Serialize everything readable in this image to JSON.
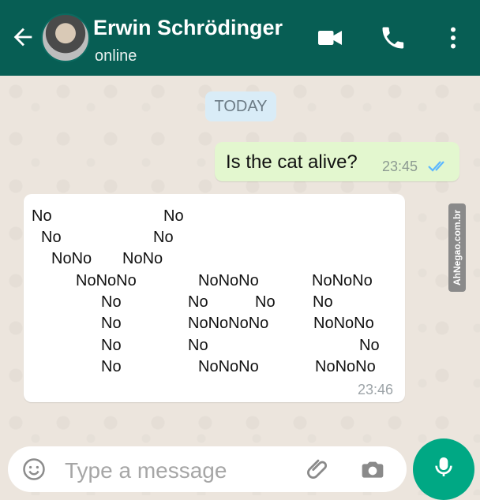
{
  "header": {
    "title": "Erwin Schrödinger",
    "status": "online"
  },
  "chat": {
    "date_label": "TODAY",
    "outgoing": {
      "text": "Is the cat alive?",
      "time": "23:45"
    },
    "incoming": {
      "time": "23:46",
      "rows": [
        {
          "parts": [
            "No",
            "No"
          ]
        },
        {
          "parts": [
            "No",
            "No"
          ]
        },
        {
          "parts": [
            "NoNo",
            "NoNo"
          ]
        },
        {
          "parts": [
            "NoNoNo",
            "NoNoNo",
            "NoNoNo"
          ]
        },
        {
          "parts": [
            "No",
            "No",
            "No",
            "No"
          ]
        },
        {
          "parts": [
            "No",
            "NoNoNoNo",
            "NoNoNo"
          ]
        },
        {
          "parts": [
            "No",
            "No",
            "No"
          ]
        },
        {
          "parts": [
            "No",
            "NoNoNo",
            "NoNoNo"
          ]
        }
      ]
    }
  },
  "watermark": "AhNegao.com.br",
  "composer": {
    "placeholder": "Type a message"
  },
  "colors": {
    "header": "#075E54",
    "chat_bg": "#ECE5DD",
    "outgoing_bubble": "#E3F7CF",
    "incoming_bubble": "#FFFFFF",
    "fab": "#00A884"
  }
}
